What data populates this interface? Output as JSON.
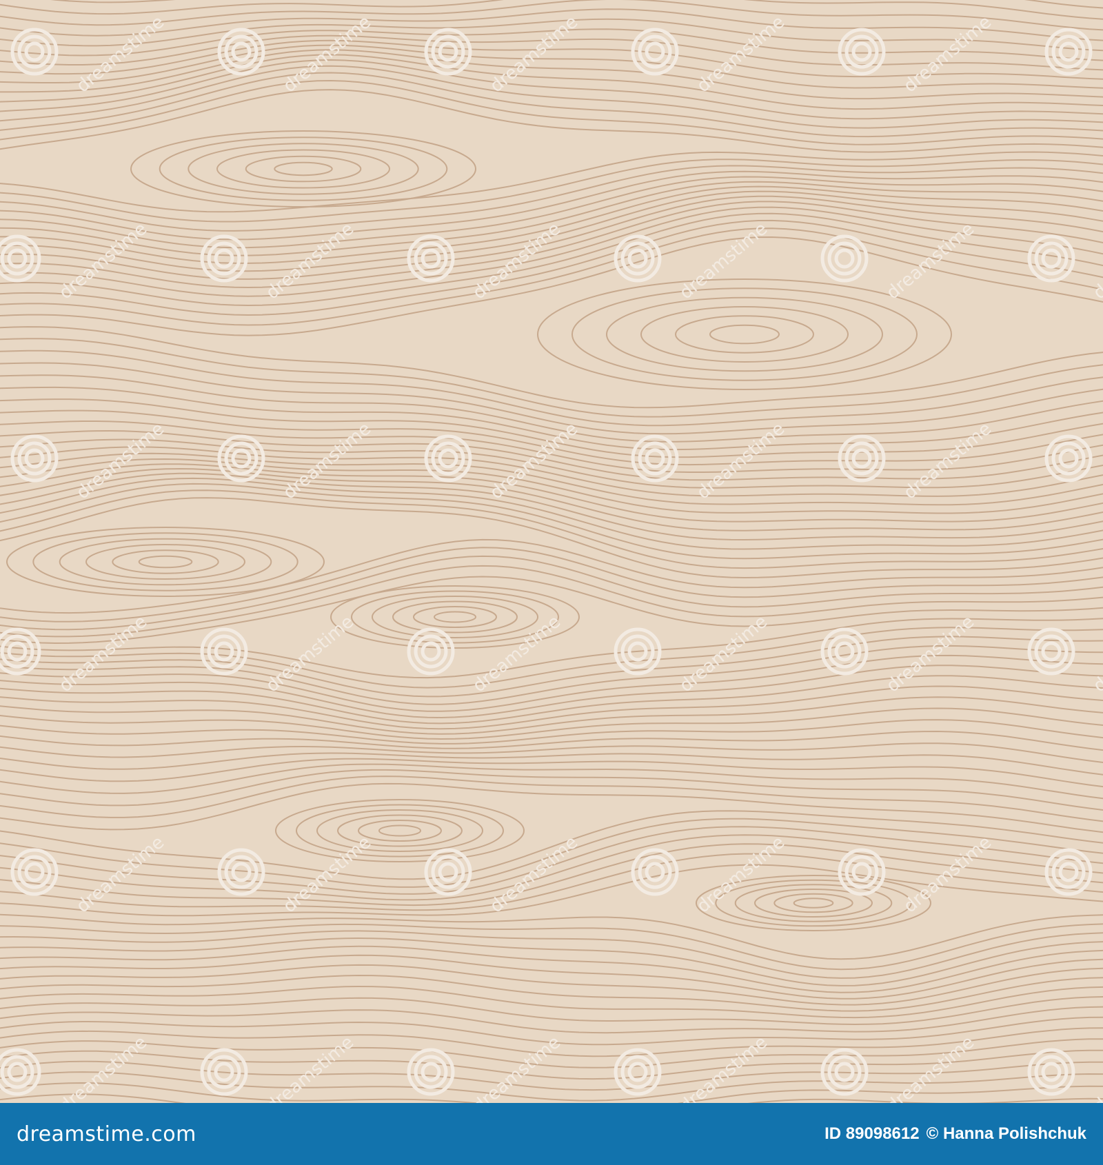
{
  "image": {
    "subject": "wood-grain-texture",
    "colors": {
      "background": "#e8d8c5",
      "grain_line": "#c7a98e",
      "watermark": "#f3ebe2",
      "bar": "#1273ad",
      "bar_text": "#ffffff"
    },
    "watermark_icon": "spiral-logo-icon",
    "watermark_text": "dreamstime"
  },
  "bottom_bar": {
    "brand": "dreamstime.com",
    "id_label": "ID 89098612",
    "credit": "© Hanna Polishchuk"
  }
}
